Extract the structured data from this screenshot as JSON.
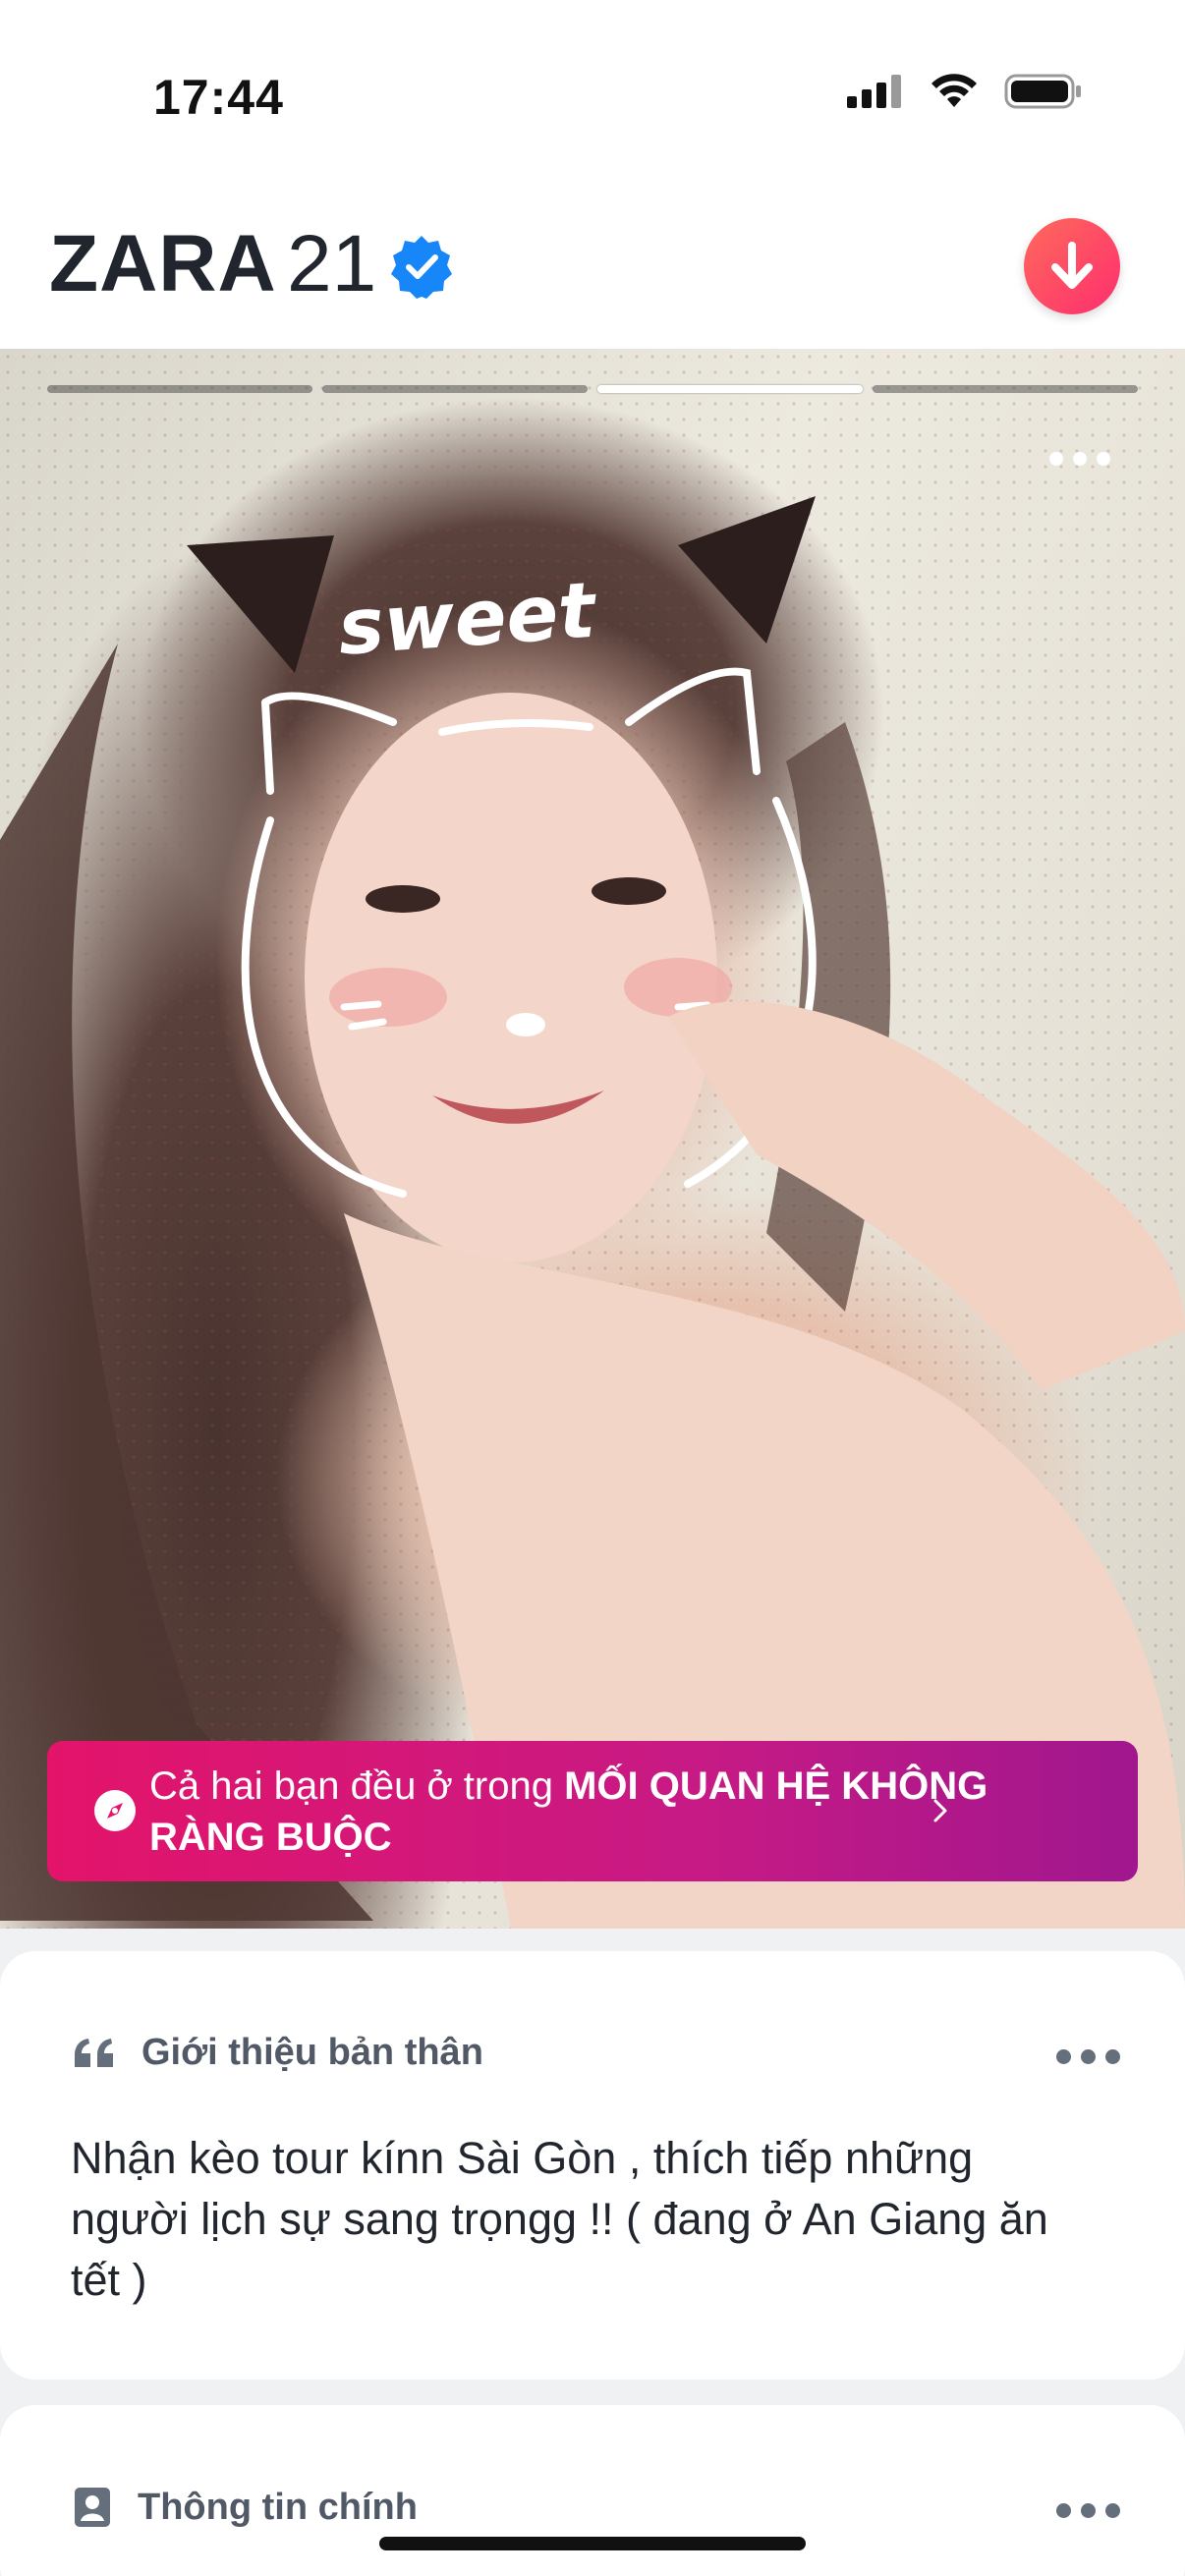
{
  "status_bar": {
    "time": "17:44"
  },
  "profile": {
    "name": "ZARA",
    "age": "21",
    "verified": true
  },
  "photo": {
    "total_photos": 4,
    "active_index": 2,
    "sticker_text": "sweet"
  },
  "banner": {
    "prefix": "Cả hai bạn đều ở trong ",
    "highlight": "MỐI QUAN HỆ KHÔNG RÀNG BUỘC",
    "icon": "compass-icon"
  },
  "about": {
    "title": "Giới thiệu bản thân",
    "icon": "quote-icon",
    "text": "Nhận kèo tour kínn Sài Gòn , thích tiếp những người lịch sự sang trọngg !! ( đang ở An Giang ăn tết )"
  },
  "basics": {
    "title": "Thông tin chính",
    "icon": "id-badge-icon"
  },
  "colors": {
    "brand_gradient_start": "#ff6a5c",
    "brand_gradient_end": "#fd2e6e",
    "banner_start": "#e3146a",
    "banner_end": "#a0178e",
    "verified": "#1786f8",
    "text_primary": "#21262e",
    "text_secondary": "#505965"
  }
}
